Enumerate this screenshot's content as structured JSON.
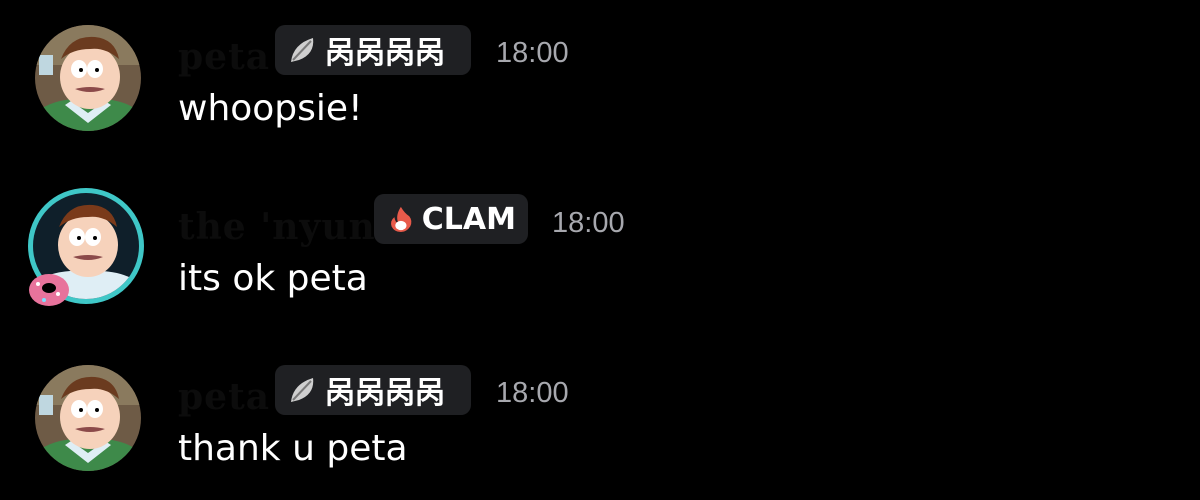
{
  "colors": {
    "background": "#000000",
    "username": "#0c0c0c",
    "tag_background": "#1f2023",
    "timestamp": "#a7a8ae",
    "message_text": "#ffffff",
    "avatar_ring": "#3fc7c7"
  },
  "messages": [
    {
      "username": "peta",
      "tag": {
        "icon": "leaf-icon",
        "label": "呙呙呙呙"
      },
      "timestamp": "18:00",
      "text": "whoopsie!"
    },
    {
      "username": "the 'nyun",
      "tag": {
        "icon": "flame-icon",
        "label": "CLAM"
      },
      "timestamp": "18:00",
      "text": "its ok peta"
    },
    {
      "username": "peta",
      "tag": {
        "icon": "leaf-icon",
        "label": "呙呙呙呙"
      },
      "timestamp": "18:00",
      "text": "thank u peta"
    }
  ]
}
